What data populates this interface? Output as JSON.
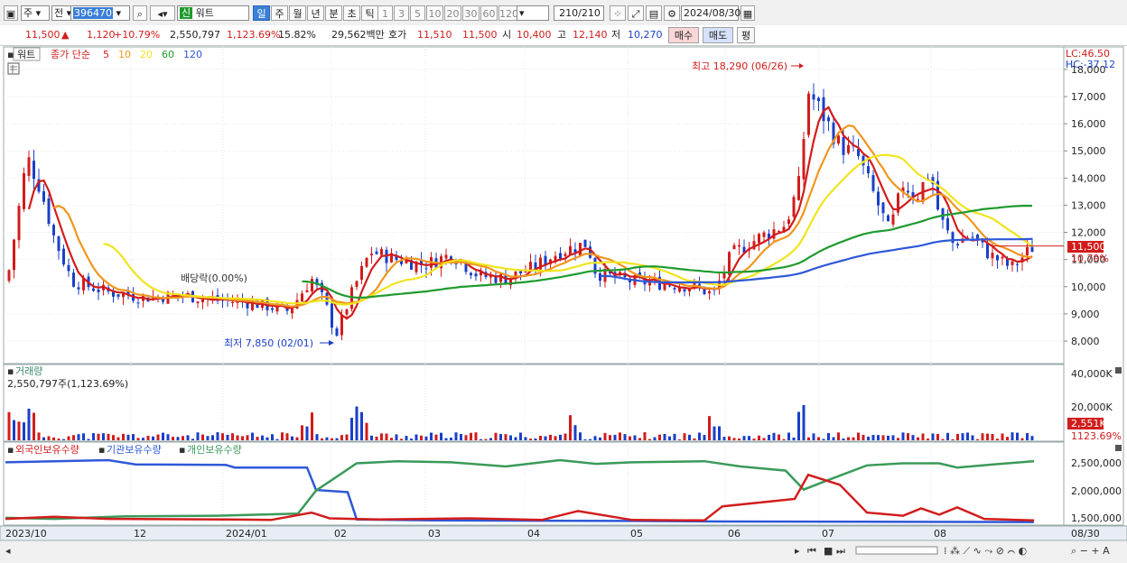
{
  "toolbar": {
    "market_select": "주",
    "compare_select": "전",
    "stock_code": "396470",
    "stock_badge": "신",
    "stock_name": "워트",
    "periods": [
      "일",
      "주",
      "월",
      "년",
      "분",
      "초",
      "틱"
    ],
    "selected_period": "일",
    "intervals": [
      "1",
      "3",
      "5",
      "10",
      "20",
      "30",
      "60",
      "120"
    ],
    "count": "210",
    "count_total": "/210",
    "date": "2024/08/30"
  },
  "info": {
    "price": "11,500",
    "change_arrow": "▲",
    "change": "1,120",
    "change_pct": "+10.79%",
    "volume": "2,550,797",
    "volume_pct": "1,123.69%",
    "turnover": "15.82%",
    "amount": "29,562백만",
    "quote_label": "호가",
    "ask": "11,510",
    "bid": "11,500",
    "open_label": "시",
    "open": "10,400",
    "high_label": "고",
    "high": "12,140",
    "low_label": "저",
    "low": "10,270",
    "buy_button": "매수",
    "sell_button": "매도",
    "eval_button": "평"
  },
  "legend": {
    "name": "워트",
    "type": "종가 단순",
    "ma": [
      {
        "label": "5",
        "color": "#d21c1c"
      },
      {
        "label": "10",
        "color": "#f0961e"
      },
      {
        "label": "20",
        "color": "#f0e41e"
      },
      {
        "label": "60",
        "color": "#1f9a2e"
      },
      {
        "label": "120",
        "color": "#2e58d8"
      }
    ]
  },
  "annotations": {
    "high": "최고 18,290 (06/26)",
    "low": "최저 7,850 (02/01)",
    "dividend": "배당락(0.00%)",
    "lc": "LC:46.50",
    "hc": "HC:-37.12",
    "price_tag": "11,500",
    "pct_tag": "10.79%",
    "volume_tag": "2,551K",
    "volume_pct_tag": "1123.69%"
  },
  "volume_panel": {
    "title": "거래량",
    "value": "2,550,797주(1,123.69%)",
    "axis": [
      "40,000K",
      "20,000K"
    ]
  },
  "holdings_panel": {
    "series": [
      {
        "label": "외국인보유수량",
        "color": "#d21c1c"
      },
      {
        "label": "기관보유수량",
        "color": "#2e58d8"
      },
      {
        "label": "개인보유수량",
        "color": "#3a9a5a"
      }
    ],
    "axis": [
      "2,500,000",
      "2,000,000",
      "1,500,000"
    ]
  },
  "x_labels": [
    "2023/10",
    "12",
    "2024/01",
    "02",
    "03",
    "04",
    "05",
    "06",
    "07",
    "08",
    "08/30"
  ],
  "chart_data": {
    "type": "candlestick",
    "y_ticks": [
      8000,
      9000,
      10000,
      11000,
      12000,
      13000,
      14000,
      15000,
      16000,
      17000,
      18000
    ],
    "y_range": [
      7500,
      19000
    ],
    "high_point": {
      "value": 18290,
      "date": "06/26"
    },
    "low_point": {
      "value": 7850,
      "date": "02/01"
    },
    "last": {
      "open": 10400,
      "high": 12140,
      "low": 10270,
      "close": 11500
    },
    "ma_levels_last": {
      "ma5": 11000,
      "ma10": 10900,
      "ma20": 11300,
      "ma60": 13050,
      "ma120": 11700
    }
  }
}
